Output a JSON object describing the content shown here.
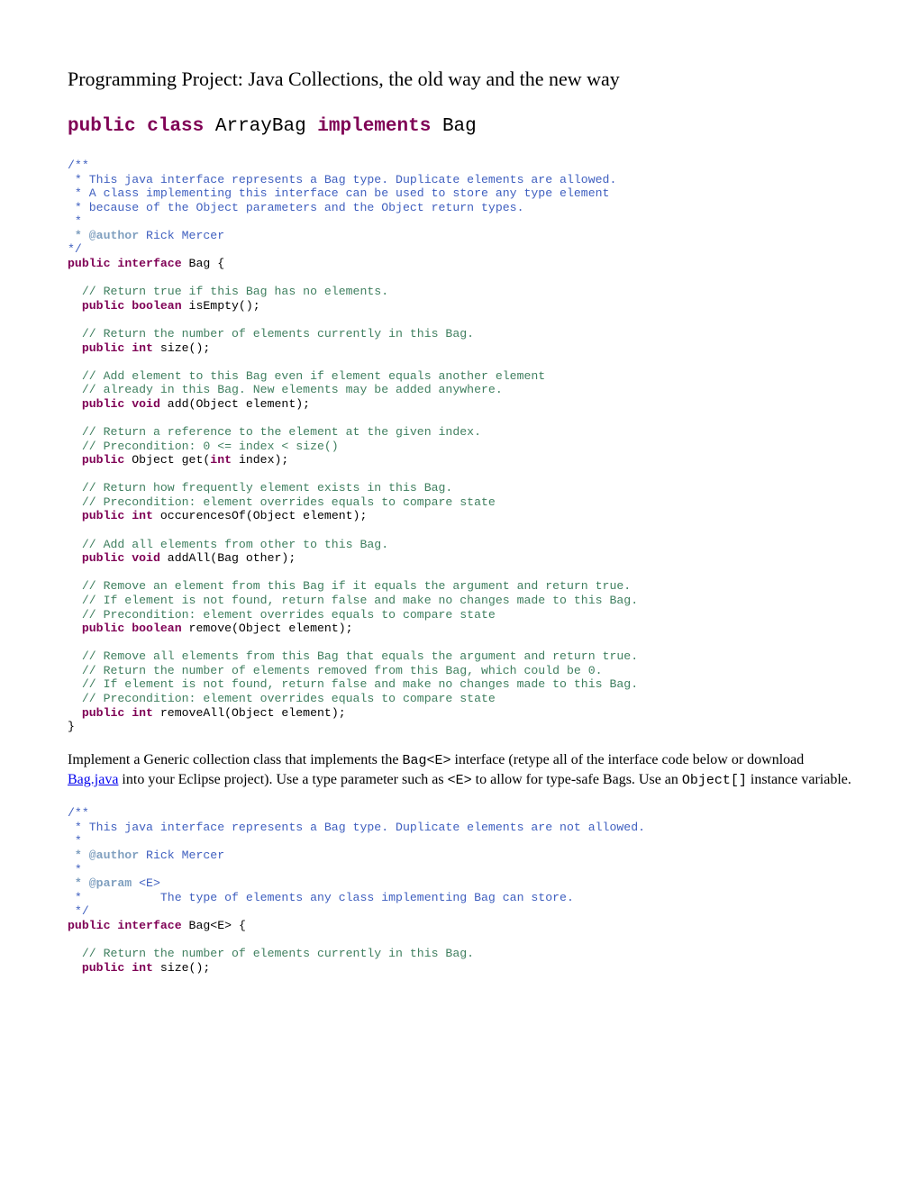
{
  "title": "Programming Project:  Java Collections, the old way and the new way",
  "subtitle": {
    "kw_public": "public",
    "kw_class": "class",
    "name": "ArrayBag",
    "kw_implements": "implements",
    "iface": "Bag"
  },
  "code1": {
    "doc_open": "/**",
    "doc_l1": " * This java interface represents a Bag type. Duplicate elements are allowed.",
    "doc_l2": " * A class implementing this interface can be used to store any type element",
    "doc_l3": " * because of the Object parameters and the Object return types.",
    "doc_l4": " *",
    "doc_author_tag": " * @author",
    "doc_author_name": " Rick Mercer",
    "doc_close": "*/",
    "decl_public": "public",
    "decl_interface": "interface",
    "decl_name": " Bag {",
    "c_isEmpty": "  // Return true if this Bag has no elements.",
    "m_isEmpty_kw1": "  public",
    "m_isEmpty_kw2": " boolean",
    "m_isEmpty_rest": " isEmpty();",
    "c_size": "  // Return the number of elements currently in this Bag.",
    "m_size_kw1": "  public",
    "m_size_kw2": " int",
    "m_size_rest": " size();",
    "c_add1": "  // Add element to this Bag even if element equals another element",
    "c_add2": "  // already in this Bag. New elements may be added anywhere.",
    "m_add_kw1": "  public",
    "m_add_kw2": " void",
    "m_add_rest": " add(Object element);",
    "c_get1": "  // Return a reference to the element at the given index.",
    "c_get2": "  // Precondition: 0 <= index < size()",
    "m_get_kw1": "  public",
    "m_get_rest": " Object get(",
    "m_get_kw2": "int",
    "m_get_rest2": " index);",
    "c_occ1": "  // Return how frequently element exists in this Bag.",
    "c_occ2": "  // Precondition: element overrides equals to compare state",
    "m_occ_kw1": "  public",
    "m_occ_kw2": " int",
    "m_occ_rest": " occurencesOf(Object element);",
    "c_addAll": "  // Add all elements from other to this Bag.",
    "m_addAll_kw1": "  public",
    "m_addAll_kw2": " void",
    "m_addAll_rest": " addAll(Bag other);",
    "c_rem1": "  // Remove an element from this Bag if it equals the argument and return true.",
    "c_rem2": "  // If element is not found, return false and make no changes made to this Bag.",
    "c_rem3": "  // Precondition: element overrides equals to compare state",
    "m_rem_kw1": "  public",
    "m_rem_kw2": " boolean",
    "m_rem_rest": " remove(Object element);",
    "c_remAll1": "  // Remove all elements from this Bag that equals the argument and return true.",
    "c_remAll2": "  // Return the number of elements removed from this Bag, which could be 0.",
    "c_remAll3": "  // If element is not found, return false and make no changes made to this Bag.",
    "c_remAll4": "  // Precondition: element overrides equals to compare state",
    "m_remAll_kw1": "  public",
    "m_remAll_kw2": " int",
    "m_remAll_rest": " removeAll(Object element);",
    "close": "}"
  },
  "para": {
    "p1a": "Implement a Generic collection class that implements the ",
    "p1_mono1": "Bag<E>",
    "p1b": " interface (retype all of the interface code below or download ",
    "p1_link": "Bag.java",
    "p1c": " into your Eclipse project).  Use a type parameter such as ",
    "p1_mono2": "<E>",
    "p1d": " to allow for type-safe Bags.  Use an ",
    "p1_mono3": "Object[]",
    "p1e": " instance variable."
  },
  "code2": {
    "doc_open": "/**",
    "doc_l1": " * This java interface represents a Bag type. Duplicate elements are not allowed.",
    "doc_l2": " *",
    "doc_author_tag": " * @author",
    "doc_author_name": " Rick Mercer",
    "doc_l3": " *",
    "doc_param_tag": " * @param",
    "doc_param_name": " <E>",
    "doc_param_desc": " *           The type of elements any class implementing Bag can store.",
    "doc_close": " */",
    "decl_public": "public",
    "decl_interface": "interface",
    "decl_name": " Bag<E> {",
    "c_size": "  // Return the number of elements currently in this Bag.",
    "m_size_kw1": "  public",
    "m_size_kw2": " int",
    "m_size_rest": " size();"
  }
}
